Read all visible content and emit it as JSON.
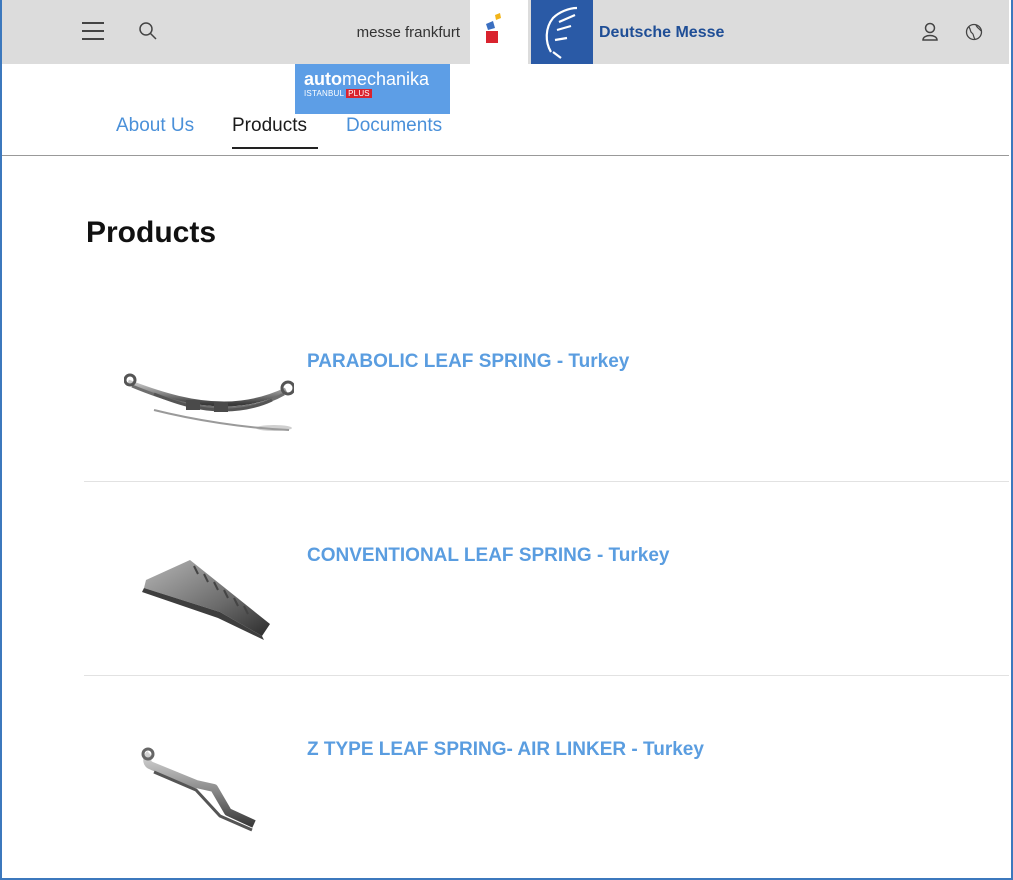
{
  "header": {
    "messe_frankfurt_label": "messe frankfurt",
    "deutsche_messe_label": "Deutsche Messe",
    "icons": [
      "menu-icon",
      "search-icon",
      "messe-frankfurt-logo",
      "deutsche-messe-logo",
      "user-icon",
      "globe-icon"
    ]
  },
  "event_logo": {
    "word_bold": "auto",
    "word_rest": "mechanika",
    "sub_city": "ISTANBUL",
    "sub_plus": "PLUS"
  },
  "tabs": [
    {
      "label": "About Us",
      "active": false
    },
    {
      "label": "Products",
      "active": true
    },
    {
      "label": "Documents",
      "active": false
    }
  ],
  "page_title": "Products",
  "products": [
    {
      "name": "PARABOLIC LEAF SPRING - Turkey"
    },
    {
      "name": "CONVENTIONAL LEAF SPRING - Turkey"
    },
    {
      "name": "Z TYPE LEAF SPRING- AIR LINKER - Turkey"
    }
  ],
  "colors": {
    "link": "#5a9de0",
    "header_bg": "#dcdcdc",
    "deutsche_messe_blue": "#2a5aa6",
    "automechanika_blue": "#5d9ee6"
  }
}
